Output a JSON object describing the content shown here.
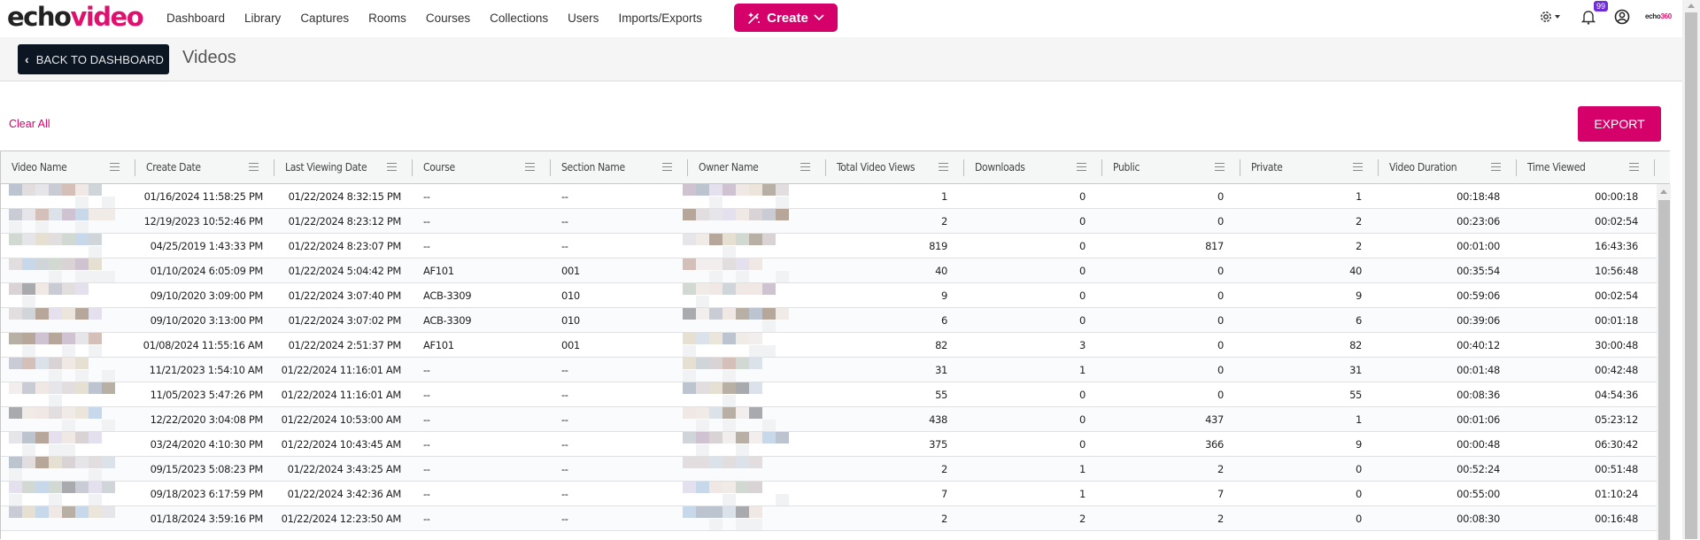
{
  "app": {
    "logo_part1": "echo",
    "logo_part2": "video",
    "brand_small_part1": "echo",
    "brand_small_part2": "360",
    "accent_color": "#d6006b"
  },
  "nav": {
    "items": [
      {
        "label": "Dashboard"
      },
      {
        "label": "Library"
      },
      {
        "label": "Captures"
      },
      {
        "label": "Rooms"
      },
      {
        "label": "Courses"
      },
      {
        "label": "Collections"
      },
      {
        "label": "Users"
      },
      {
        "label": "Imports/Exports"
      }
    ],
    "create_label": "Create",
    "notifications_count": "99",
    "icons": [
      "settings-icon",
      "bell-icon",
      "user-icon"
    ]
  },
  "subheader": {
    "back_label": "BACK TO DASHBOARD",
    "title": "Videos"
  },
  "toolbar": {
    "clear_all_label": "Clear All",
    "export_label": "EXPORT"
  },
  "table": {
    "columns": [
      {
        "label": "Video Name"
      },
      {
        "label": "Create Date"
      },
      {
        "label": "Last Viewing Date"
      },
      {
        "label": "Course"
      },
      {
        "label": "Section Name"
      },
      {
        "label": "Owner Name"
      },
      {
        "label": "Total Video Views"
      },
      {
        "label": "Downloads"
      },
      {
        "label": "Public"
      },
      {
        "label": "Private"
      },
      {
        "label": "Video Duration"
      },
      {
        "label": "Time Viewed"
      }
    ],
    "rows": [
      {
        "create_date": "01/16/2024 11:58:25 PM",
        "last_viewing_date": "01/22/2024 8:32:15 PM",
        "course": "--",
        "section": "--",
        "views": "1",
        "downloads": "0",
        "public": "0",
        "private": "1",
        "duration": "00:18:48",
        "time_viewed": "00:00:18"
      },
      {
        "create_date": "12/19/2023 10:52:46 PM",
        "last_viewing_date": "01/22/2024 8:23:12 PM",
        "course": "--",
        "section": "--",
        "views": "2",
        "downloads": "0",
        "public": "0",
        "private": "2",
        "duration": "00:23:06",
        "time_viewed": "00:02:54"
      },
      {
        "create_date": "04/25/2019 1:43:33 PM",
        "last_viewing_date": "01/22/2024 8:23:07 PM",
        "course": "--",
        "section": "--",
        "views": "819",
        "downloads": "0",
        "public": "817",
        "private": "2",
        "duration": "00:01:00",
        "time_viewed": "16:43:36"
      },
      {
        "create_date": "01/10/2024 6:05:09 PM",
        "last_viewing_date": "01/22/2024 5:04:42 PM",
        "course": "AF101",
        "section": "001",
        "views": "40",
        "downloads": "0",
        "public": "0",
        "private": "40",
        "duration": "00:35:54",
        "time_viewed": "10:56:48"
      },
      {
        "create_date": "09/10/2020 3:09:00 PM",
        "last_viewing_date": "01/22/2024 3:07:40 PM",
        "course": "ACB-3309",
        "section": "010",
        "views": "9",
        "downloads": "0",
        "public": "0",
        "private": "9",
        "duration": "00:59:06",
        "time_viewed": "00:02:54"
      },
      {
        "create_date": "09/10/2020 3:13:00 PM",
        "last_viewing_date": "01/22/2024 3:07:02 PM",
        "course": "ACB-3309",
        "section": "010",
        "views": "6",
        "downloads": "0",
        "public": "0",
        "private": "6",
        "duration": "00:39:06",
        "time_viewed": "00:01:18"
      },
      {
        "create_date": "01/08/2024 11:55:16 AM",
        "last_viewing_date": "01/22/2024 2:51:37 PM",
        "course": "AF101",
        "section": "001",
        "views": "82",
        "downloads": "3",
        "public": "0",
        "private": "82",
        "duration": "00:40:12",
        "time_viewed": "30:00:48"
      },
      {
        "create_date": "11/21/2023 1:54:10 AM",
        "last_viewing_date": "01/22/2024 11:16:01 AM",
        "course": "--",
        "section": "--",
        "views": "31",
        "downloads": "1",
        "public": "0",
        "private": "31",
        "duration": "00:01:48",
        "time_viewed": "00:42:48"
      },
      {
        "create_date": "11/05/2023 5:47:26 PM",
        "last_viewing_date": "01/22/2024 11:16:01 AM",
        "course": "--",
        "section": "--",
        "views": "55",
        "downloads": "0",
        "public": "0",
        "private": "55",
        "duration": "00:08:36",
        "time_viewed": "04:54:36"
      },
      {
        "create_date": "12/22/2020 3:04:08 PM",
        "last_viewing_date": "01/22/2024 10:53:00 AM",
        "course": "--",
        "section": "--",
        "views": "438",
        "downloads": "0",
        "public": "437",
        "private": "1",
        "duration": "00:01:06",
        "time_viewed": "05:23:12"
      },
      {
        "create_date": "03/24/2020 4:10:30 PM",
        "last_viewing_date": "01/22/2024 10:43:45 AM",
        "course": "--",
        "section": "--",
        "views": "375",
        "downloads": "0",
        "public": "366",
        "private": "9",
        "duration": "00:00:48",
        "time_viewed": "06:30:42"
      },
      {
        "create_date": "09/15/2023 5:08:23 PM",
        "last_viewing_date": "01/22/2024 3:43:25 AM",
        "course": "--",
        "section": "--",
        "views": "2",
        "downloads": "1",
        "public": "2",
        "private": "0",
        "duration": "00:52:24",
        "time_viewed": "00:51:48"
      },
      {
        "create_date": "09/18/2023 6:17:59 PM",
        "last_viewing_date": "01/22/2024 3:42:36 AM",
        "course": "--",
        "section": "--",
        "views": "7",
        "downloads": "1",
        "public": "7",
        "private": "0",
        "duration": "00:55:00",
        "time_viewed": "01:10:24"
      },
      {
        "create_date": "01/18/2024 3:59:16 PM",
        "last_viewing_date": "01/22/2024 12:23:50 AM",
        "course": "--",
        "section": "--",
        "views": "2",
        "downloads": "2",
        "public": "2",
        "private": "0",
        "duration": "00:08:30",
        "time_viewed": "00:16:48"
      }
    ]
  }
}
